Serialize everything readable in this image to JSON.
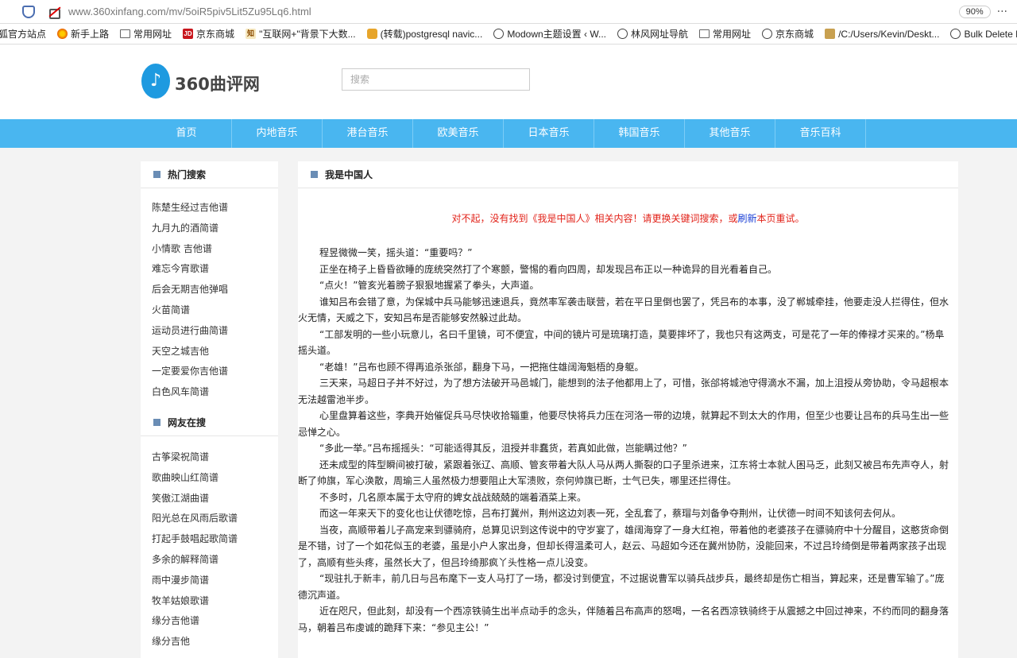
{
  "browser": {
    "url": "www.360xinfang.com/mv/5oiR5piv5Lit5Zu95Lq6.html",
    "zoom": "90%",
    "bookmarks": [
      {
        "label": "狐官方站点",
        "icon": "firefox-icon"
      },
      {
        "label": "新手上路",
        "icon": "firefox-icon"
      },
      {
        "label": "常用网址",
        "icon": "folder-icon"
      },
      {
        "label": "京东商城",
        "icon": "jd-icon"
      },
      {
        "label": "\"互联网+\"背景下大数...",
        "icon": "zhi-icon"
      },
      {
        "label": "(转载)postgresql navic...",
        "icon": "postgres-icon"
      },
      {
        "label": "Modown主题设置 ‹ W...",
        "icon": "globe-icon"
      },
      {
        "label": "林风网址导航",
        "icon": "globe-icon"
      },
      {
        "label": "常用网址",
        "icon": "folder-icon"
      },
      {
        "label": "京东商城",
        "icon": "globe-icon"
      },
      {
        "label": "/C:/Users/Kevin/Deskt...",
        "icon": "file-icon"
      },
      {
        "label": "Bulk Delete Posts ‹",
        "icon": "globe-icon"
      }
    ]
  },
  "site": {
    "logo_text": "360曲评网",
    "search_placeholder": "搜索",
    "nav": [
      "首页",
      "内地音乐",
      "港台音乐",
      "欧美音乐",
      "日本音乐",
      "韩国音乐",
      "其他音乐",
      "音乐百科"
    ]
  },
  "sidebar": {
    "hot_title": "热门搜索",
    "hot_items": [
      "陈楚生经过吉他谱",
      "九月九的酒简谱",
      "小情歌 吉他谱",
      "难忘今宵歌谱",
      "后会无期吉他弹唱",
      "火苗简谱",
      "运动员进行曲简谱",
      "天空之城吉他",
      "一定要爱你吉他谱",
      "白色风车简谱"
    ],
    "net_title": "网友在搜",
    "net_items": [
      "古筝梁祝简谱",
      "歌曲映山红简谱",
      "笑傲江湖曲谱",
      "阳光总在风雨后歌谱",
      "打起手鼓唱起歌简谱",
      "多余的解释简谱",
      "雨中漫步简谱",
      "牧羊姑娘歌谱",
      "缘分吉他谱",
      "缘分吉他"
    ]
  },
  "main": {
    "title": "我是中国人",
    "notice_before": "对不起，没有找到《我是中国人》相关内容！请更换关键词搜索，或",
    "notice_link": "刷新",
    "notice_after": "本页重试。",
    "paragraphs": [
      "程昱微微一笑，摇头道：“重要吗？”",
      "正坐在椅子上昏昏欲睡的庞统突然打了个寒颤，警惕的看向四周，却发现吕布正以一种诡异的目光看着自己。",
      "“点火！”管亥光着膀子狠狠地握紧了拳头，大声道。",
      "谁知吕布会错了意，为保城中兵马能够迅速退兵，竟然率军袭击联营，若在平日里倒也罢了，凭吕布的本事，没了郸城牵挂，他要走没人拦得住，但水火无情，天威之下，安知吕布是否能够安然躲过此劫。",
      "“工部发明的一些小玩意儿，名曰千里镜，可不便宜，中间的镜片可是琉璃打造，莫要摔坏了，我也只有这两支，可是花了一年的俸禄才买来的。”杨阜摇头道。",
      "“老雄！”吕布也顾不得再追杀张郃，翻身下马，一把拖住雄阔海魁梧的身躯。",
      "三天来，马超日子并不好过，为了想方法破开马邑城门，能想到的法子他都用上了，可惜，张郃将城池守得滴水不漏，加上沮授从旁协助，令马超根本无法越雷池半步。",
      "心里盘算着这些，李典开始催促兵马尽快收拾辎重，他要尽快将兵力压在河洛一带的边境，就算起不到太大的作用，但至少也要让吕布的兵马生出一些忌惮之心。",
      "“多此一举。”吕布摇摇头：“可能适得其反，沮授并非蠢货，若真如此做，岂能瞒过他？”",
      "还未成型的阵型瞬间被打破，紧跟着张辽、高顺、管亥带着大队人马从两人撕裂的口子里杀进来，江东将士本就人困马乏，此刻又被吕布先声夺人，射断了帅旗，军心涣散，周瑜三人虽然极力想要阻止大军溃败，奈何帅旗已断，士气已失，哪里还拦得住。",
      "不多时，几名原本属于太守府的婢女战战兢兢的端着酒菜上来。",
      "而这一年来天下的变化也让伏德吃惊，吕布打冀州，荆州这边刘表一死，全乱套了，蔡瑁与刘备争夺荆州，让伏德一时间不知该何去何从。",
      "当夜，高顺带着儿子高宠来到骠骑府，总算见识到这传说中的守岁宴了，雄阔海穿了一身大红袍，带着他的老婆孩子在骠骑府中十分醒目，这憨货命倒是不错，讨了一个如花似玉的老婆，虽是小户人家出身，但却长得温柔可人，赵云、马超如今还在冀州协防，没能回来，不过吕玲绮倒是带着两家孩子出现了，高顺有些头疼，虽然长大了，但吕玲绮那疯丫头性格一点儿没变。",
      "“现驻扎于新丰，前几日与吕布麾下一支人马打了一场，都没讨到便宜，不过据说曹军以骑兵战步兵，最终却是伤亡相当，算起来，还是曹军输了。”庞德沉声道。",
      "近在咫尺，但此刻，却没有一个西凉铁骑生出半点动手的念头，伴随着吕布高声的怒喝，一名名西凉铁骑终于从震撼之中回过神来，不约而同的翻身落马，朝着吕布虔诚的跪拜下来：“参见主公！”"
    ]
  }
}
